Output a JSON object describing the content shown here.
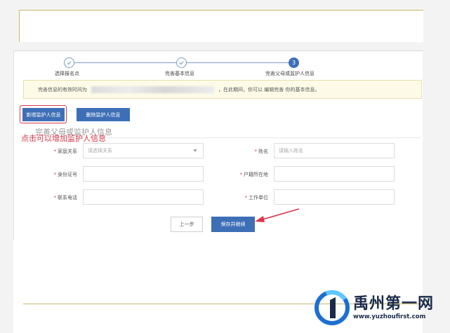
{
  "stepper": {
    "steps": [
      {
        "label": "选择报名点",
        "state": "done"
      },
      {
        "label": "完善基本信息",
        "state": "done"
      },
      {
        "label": "完善父母或监护人信息",
        "state": "active",
        "number": "3"
      }
    ]
  },
  "notice": {
    "prefix": "完善信息的有效时间为",
    "suffix": "，在此期间，你可以 编辑完善 你的基本信息。"
  },
  "toolbar": {
    "add_guardian_label": "新增监护人信息",
    "delete_guardian_label": "删除监护人信息"
  },
  "section": {
    "title": "完善父母或监护人信息",
    "annotation": "点击可以增加监护人信息"
  },
  "form": {
    "relation": {
      "label": "家庭关系",
      "placeholder": "请选择关系"
    },
    "name": {
      "label": "姓名",
      "placeholder": "请输入姓名"
    },
    "id_number": {
      "label": "身份证号",
      "placeholder": ""
    },
    "household": {
      "label": "户籍所在地",
      "placeholder": ""
    },
    "phone": {
      "label": "联系电话",
      "placeholder": ""
    },
    "work_unit": {
      "label": "工作单位",
      "placeholder": ""
    }
  },
  "actions": {
    "prev_label": "上一步",
    "save_label": "保存并继续"
  },
  "brand": {
    "name": "禹州第一网",
    "url": "www.yuzhoufirst.com",
    "colors": {
      "primary": "#3e6fb6",
      "accent": "#d8384a",
      "logo_blue": "#1d6fd1",
      "logo_dark": "#1a2b4a"
    }
  }
}
